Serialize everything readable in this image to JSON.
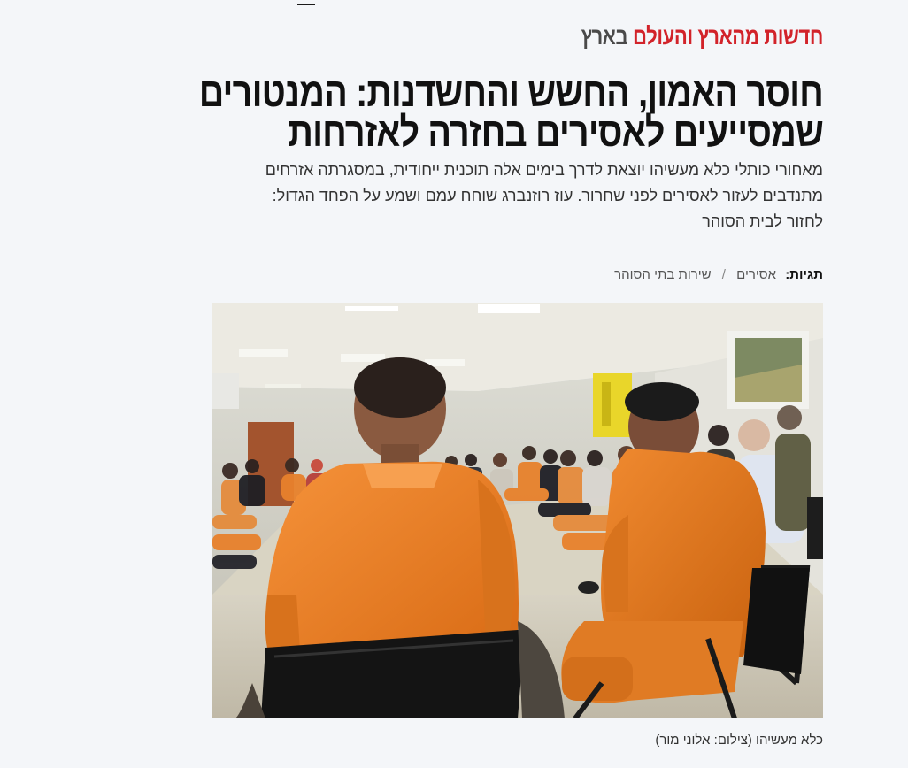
{
  "article": {
    "kicker": {
      "section": "חדשות מהארץ והעולם",
      "subsection": "בארץ"
    },
    "headline": {
      "line1": "חוסר האמון, החשש והחשדנות: המנטורים",
      "line2": "שמסייעים לאסירים בחזרה לאזרחות"
    },
    "subhead": {
      "line1": "מאחורי כותלי כלא מעשיהו יוצאת לדרך בימים אלה תוכנית ייחודית, במסגרתה אזרחים",
      "line2": "מתנדבים לעזור לאסירים לפני שחרור. עוז רוזנברג שוחח עמם ושמע על הפחד הגדול:",
      "line3": "לחזור לבית הסוהר"
    },
    "tags": {
      "label": "תגיות:",
      "items": [
        "אסירים",
        "שירות בתי הסוהר"
      ],
      "separator": "/"
    },
    "photo": {
      "caption": "כלא מעשיהו (צילום: אלוני מור)"
    }
  },
  "colors": {
    "accent": "#d2232a",
    "background": "#f4f6f9",
    "prison_uniform": "#ee7f22"
  }
}
